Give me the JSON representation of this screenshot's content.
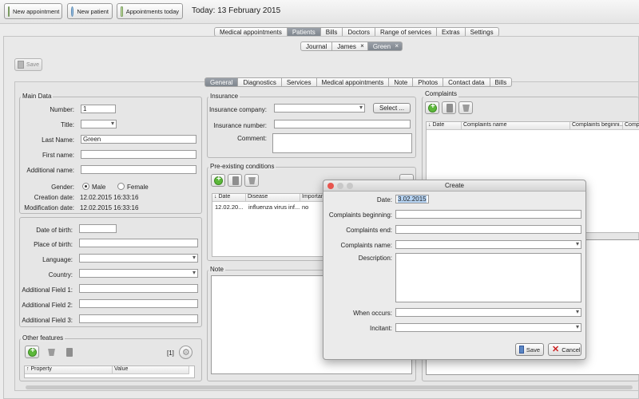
{
  "toolbar": {
    "new_appointment": "New appointment",
    "new_patient": "New patient",
    "appointments_today": "Appointments today",
    "today": "Today: 13 February 2015"
  },
  "main_tabs": [
    "Medical appointments",
    "Patients",
    "Bills",
    "Doctors",
    "Range of services",
    "Extras",
    "Settings"
  ],
  "patient_tabs": [
    "Journal",
    "James",
    "Green"
  ],
  "save_label": "Save",
  "detail_tabs": [
    "General",
    "Diagnostics",
    "Services",
    "Medical appointments",
    "Note",
    "Photos",
    "Contact data",
    "Bills"
  ],
  "main_data": {
    "title": "Main Data",
    "number_label": "Number:",
    "number": "1",
    "title_label": "Title:",
    "last_name_label": "Last Name:",
    "last_name": "Green",
    "first_name_label": "First name:",
    "additional_name_label": "Additional name:",
    "gender_label": "Gender:",
    "male": "Male",
    "female": "Female",
    "creation_label": "Creation date:",
    "creation": "12.02.2015  16:33:16",
    "modification_label": "Modification date:",
    "modification": "12.02.2015  16:33:16"
  },
  "birth": {
    "dob_label": "Date of birth:",
    "pob_label": "Place of birth:",
    "language_label": "Language:",
    "country_label": "Country:",
    "add1_label": "Additional Field 1:",
    "add2_label": "Additional Field 2:",
    "add3_label": "Additional Field 3:"
  },
  "other": {
    "title": "Other features",
    "count": "[1]",
    "col_property": "↑ Property",
    "col_value": "Value"
  },
  "insurance": {
    "title": "Insurance",
    "company_label": "Insurance company:",
    "select_label": "Select ...",
    "number_label": "Insurance number:",
    "comment_label": "Comment:"
  },
  "preexisting": {
    "title": "Pre-existing conditions",
    "columns": [
      "↓ Date",
      "Disease",
      "Importan"
    ],
    "rows": [
      [
        "12.02.20...",
        "influenza virus inf...",
        "no"
      ]
    ]
  },
  "note": {
    "title": "Note"
  },
  "complaints": {
    "title": "Complaints",
    "columns": [
      "↓ Date",
      "Complaints name",
      "Complaints beginni...",
      "Compl"
    ]
  },
  "dialog": {
    "title": "Create",
    "date_label": "Date:",
    "date": "3.02.2015",
    "beginning_label": "Complaints beginning:",
    "end_label": "Complaints end:",
    "name_label": "Complaints name:",
    "description_label": "Description:",
    "occurs_label": "When occurs:",
    "incitant_label": "Incitant:",
    "save": "Save",
    "cancel": "Cancel"
  },
  "colors": {
    "active_tab": "#8a9098",
    "accent_green": "#5cb83a",
    "cancel_red": "#cc2222"
  }
}
